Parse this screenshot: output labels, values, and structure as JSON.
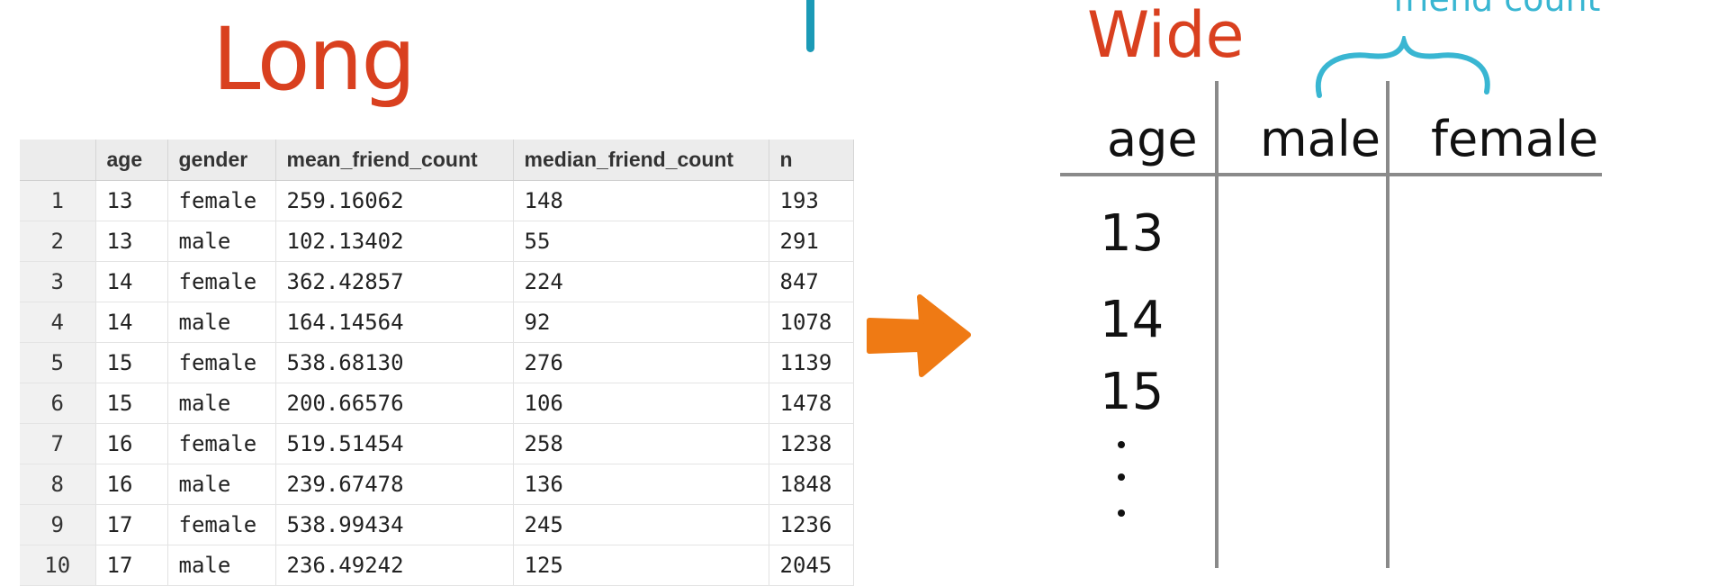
{
  "long_title": "Long",
  "wide_title": "Wide",
  "friend_count_label": "friend count",
  "table": {
    "headers": [
      "",
      "age",
      "gender",
      "mean_friend_count",
      "median_friend_count",
      "n"
    ],
    "rows": [
      [
        "1",
        "13",
        "female",
        "259.16062",
        "148",
        "193"
      ],
      [
        "2",
        "13",
        "male",
        "102.13402",
        "55",
        "291"
      ],
      [
        "3",
        "14",
        "female",
        "362.42857",
        "224",
        "847"
      ],
      [
        "4",
        "14",
        "male",
        "164.14564",
        "92",
        "1078"
      ],
      [
        "5",
        "15",
        "female",
        "538.68130",
        "276",
        "1139"
      ],
      [
        "6",
        "15",
        "male",
        "200.66576",
        "106",
        "1478"
      ],
      [
        "7",
        "16",
        "female",
        "519.51454",
        "258",
        "1238"
      ],
      [
        "8",
        "16",
        "male",
        "239.67478",
        "136",
        "1848"
      ],
      [
        "9",
        "17",
        "female",
        "538.99434",
        "245",
        "1236"
      ],
      [
        "10",
        "17",
        "male",
        "236.49242",
        "125",
        "2045"
      ]
    ]
  },
  "wide_table": {
    "headers": [
      "age",
      "male",
      "female"
    ],
    "ages": [
      "13",
      "14",
      "15"
    ]
  },
  "colors": {
    "title_red": "#d9401f",
    "arrow_orange": "#ef7a14",
    "annotation_blue": "#39b6d2"
  }
}
